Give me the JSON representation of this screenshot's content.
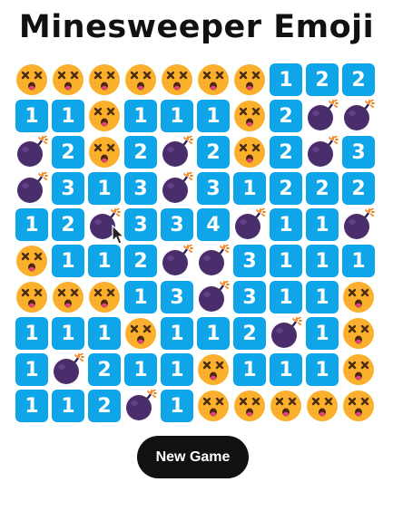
{
  "title": "Minesweeper Emoji",
  "new_game_label": "New Game",
  "legend": {
    "B": "bomb",
    "D": "dead-face",
    "number": "revealed count"
  },
  "board": [
    [
      "D",
      "D",
      "D",
      "D",
      "D",
      "D",
      "D",
      "1",
      "2",
      "2"
    ],
    [
      "1",
      "1",
      "D",
      "1",
      "1",
      "1",
      "D",
      "2",
      "B",
      "B"
    ],
    [
      "B",
      "2",
      "D",
      "2",
      "B",
      "2",
      "D",
      "2",
      "B",
      "3"
    ],
    [
      "B",
      "3",
      "1",
      "3",
      "B",
      "3",
      "1",
      "2",
      "2",
      "2"
    ],
    [
      "1",
      "2",
      "B",
      "3",
      "3",
      "4",
      "B",
      "1",
      "1",
      "B"
    ],
    [
      "D",
      "1",
      "1",
      "2",
      "B",
      "B",
      "3",
      "1",
      "1",
      "1"
    ],
    [
      "D",
      "D",
      "D",
      "1",
      "3",
      "B",
      "3",
      "1",
      "1",
      "D"
    ],
    [
      "1",
      "1",
      "1",
      "D",
      "1",
      "1",
      "2",
      "B",
      "1",
      "D"
    ],
    [
      "1",
      "B",
      "2",
      "1",
      "1",
      "D",
      "1",
      "1",
      "1",
      "D"
    ],
    [
      "1",
      "1",
      "2",
      "B",
      "1",
      "D",
      "D",
      "D",
      "D",
      "D"
    ]
  ],
  "colors": {
    "number_tile": "#0ea5e9",
    "face": "#fbb02d",
    "bomb": "#4a2e6b",
    "spark": "#f4892a",
    "button": "#111111"
  }
}
